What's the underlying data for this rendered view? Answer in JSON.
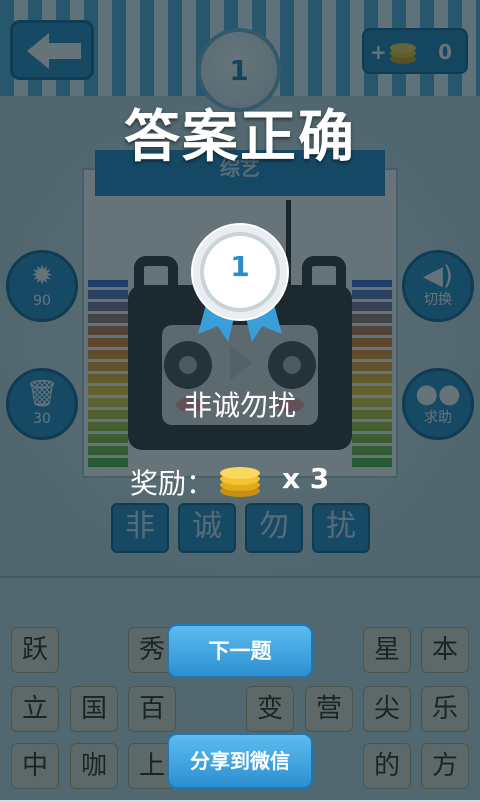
{
  "header": {
    "level": "1",
    "coin_plus": "+",
    "coin_count": "0"
  },
  "puzzle": {
    "category": "综艺",
    "hint_cost": "90",
    "delete_cost": "30",
    "switch_label": "切换",
    "help_label": "求助",
    "answer_slots": [
      "非",
      "诚",
      "勿",
      "扰"
    ]
  },
  "letter_pool": {
    "row1": [
      "跃",
      "",
      "秀",
      "",
      "",
      "",
      "星",
      "本"
    ],
    "row2": [
      "立",
      "国",
      "百",
      "",
      "变",
      "营",
      "尖",
      "乐"
    ],
    "row3": [
      "中",
      "咖",
      "上",
      "",
      "",
      "",
      "的",
      "方"
    ]
  },
  "result": {
    "title": "答案正确",
    "medal_number": "1",
    "answer": "非诚勿扰",
    "reward_label": "奖励：",
    "reward_multiplier": "x 3",
    "next_button": "下一题",
    "share_button": "分享到微信"
  },
  "colors": {
    "primary_blue": "#2f8fc4",
    "button_blue": "#3aa3e0",
    "coin_gold": "#f2c230",
    "overlay": "#0b2a36"
  }
}
